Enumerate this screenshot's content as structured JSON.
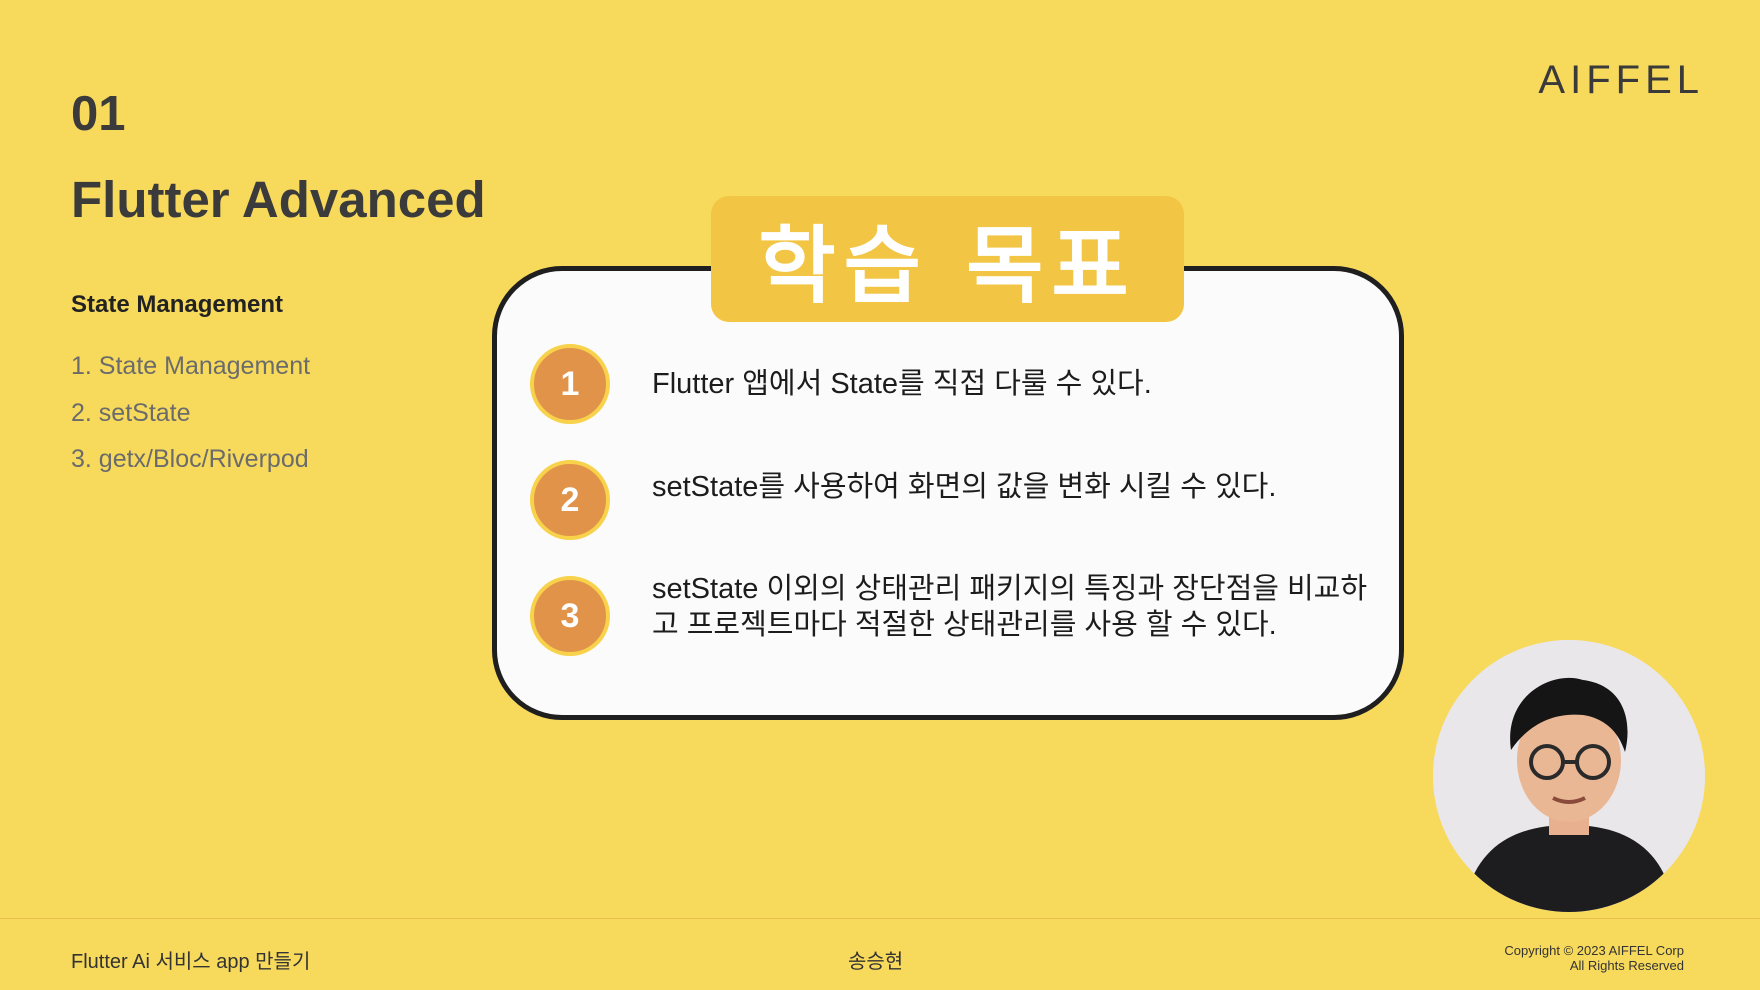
{
  "slide": {
    "section_number": "01",
    "course_title": "Flutter Advanced",
    "topic_heading": "State Management",
    "topics": [
      "1. State Management",
      "2. setState",
      "3. getx/Bloc/Riverpod"
    ],
    "logo_text": "AIFFEL"
  },
  "goals": {
    "title": "학습 목표",
    "items": [
      {
        "number": "1",
        "text": "Flutter 앱에서 State를 직접 다룰 수 있다."
      },
      {
        "number": "2",
        "text": "setState를 사용하여 화면의 값을 변화 시킬 수 있다."
      },
      {
        "number": "3",
        "text": "setState 이외의 상태관리 패키지의 특징과 장단점을 비교하고 프로젝트마다 적절한 상태관리를 사용 할 수 있다."
      }
    ]
  },
  "footer": {
    "course_name": "Flutter Ai 서비스 app 만들기",
    "presenter": "송승현",
    "copyright_line1": "Copyright © 2023 AIFFEL Corp",
    "copyright_line2": "All Rights Reserved"
  },
  "colors": {
    "background": "#f7da5c",
    "tab": "#f3c544",
    "badge": "#e1934a",
    "badge_ring": "#f7d24a"
  }
}
